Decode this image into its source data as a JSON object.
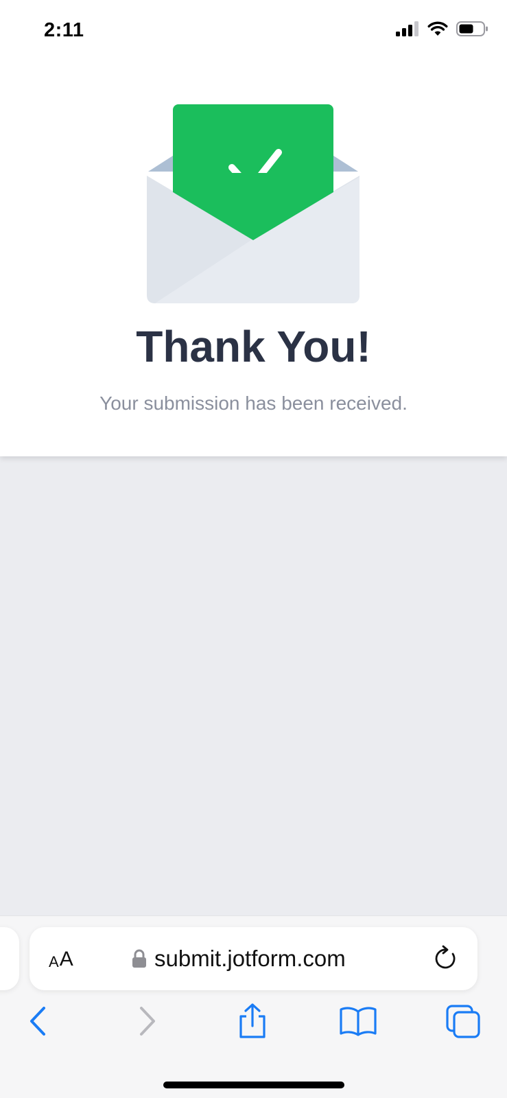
{
  "status_bar": {
    "time": "2:11",
    "icons": [
      "cellular-signal-icon",
      "wifi-icon",
      "battery-icon"
    ]
  },
  "thank_you": {
    "title": "Thank You!",
    "subtitle": "Your submission has been received.",
    "illustration": "envelope-check-icon",
    "accent_color": "#1bbe5c"
  },
  "browser": {
    "text_size_label_small": "A",
    "text_size_label_large": "A",
    "url": "submit.jotform.com",
    "icons": {
      "lock": "lock-icon",
      "reload": "reload-icon",
      "back": "back-chevron-icon",
      "forward": "forward-chevron-icon",
      "share": "share-icon",
      "bookmarks": "bookmarks-icon",
      "tabs": "tabs-icon"
    },
    "accent_color": "#1a7cf5"
  }
}
